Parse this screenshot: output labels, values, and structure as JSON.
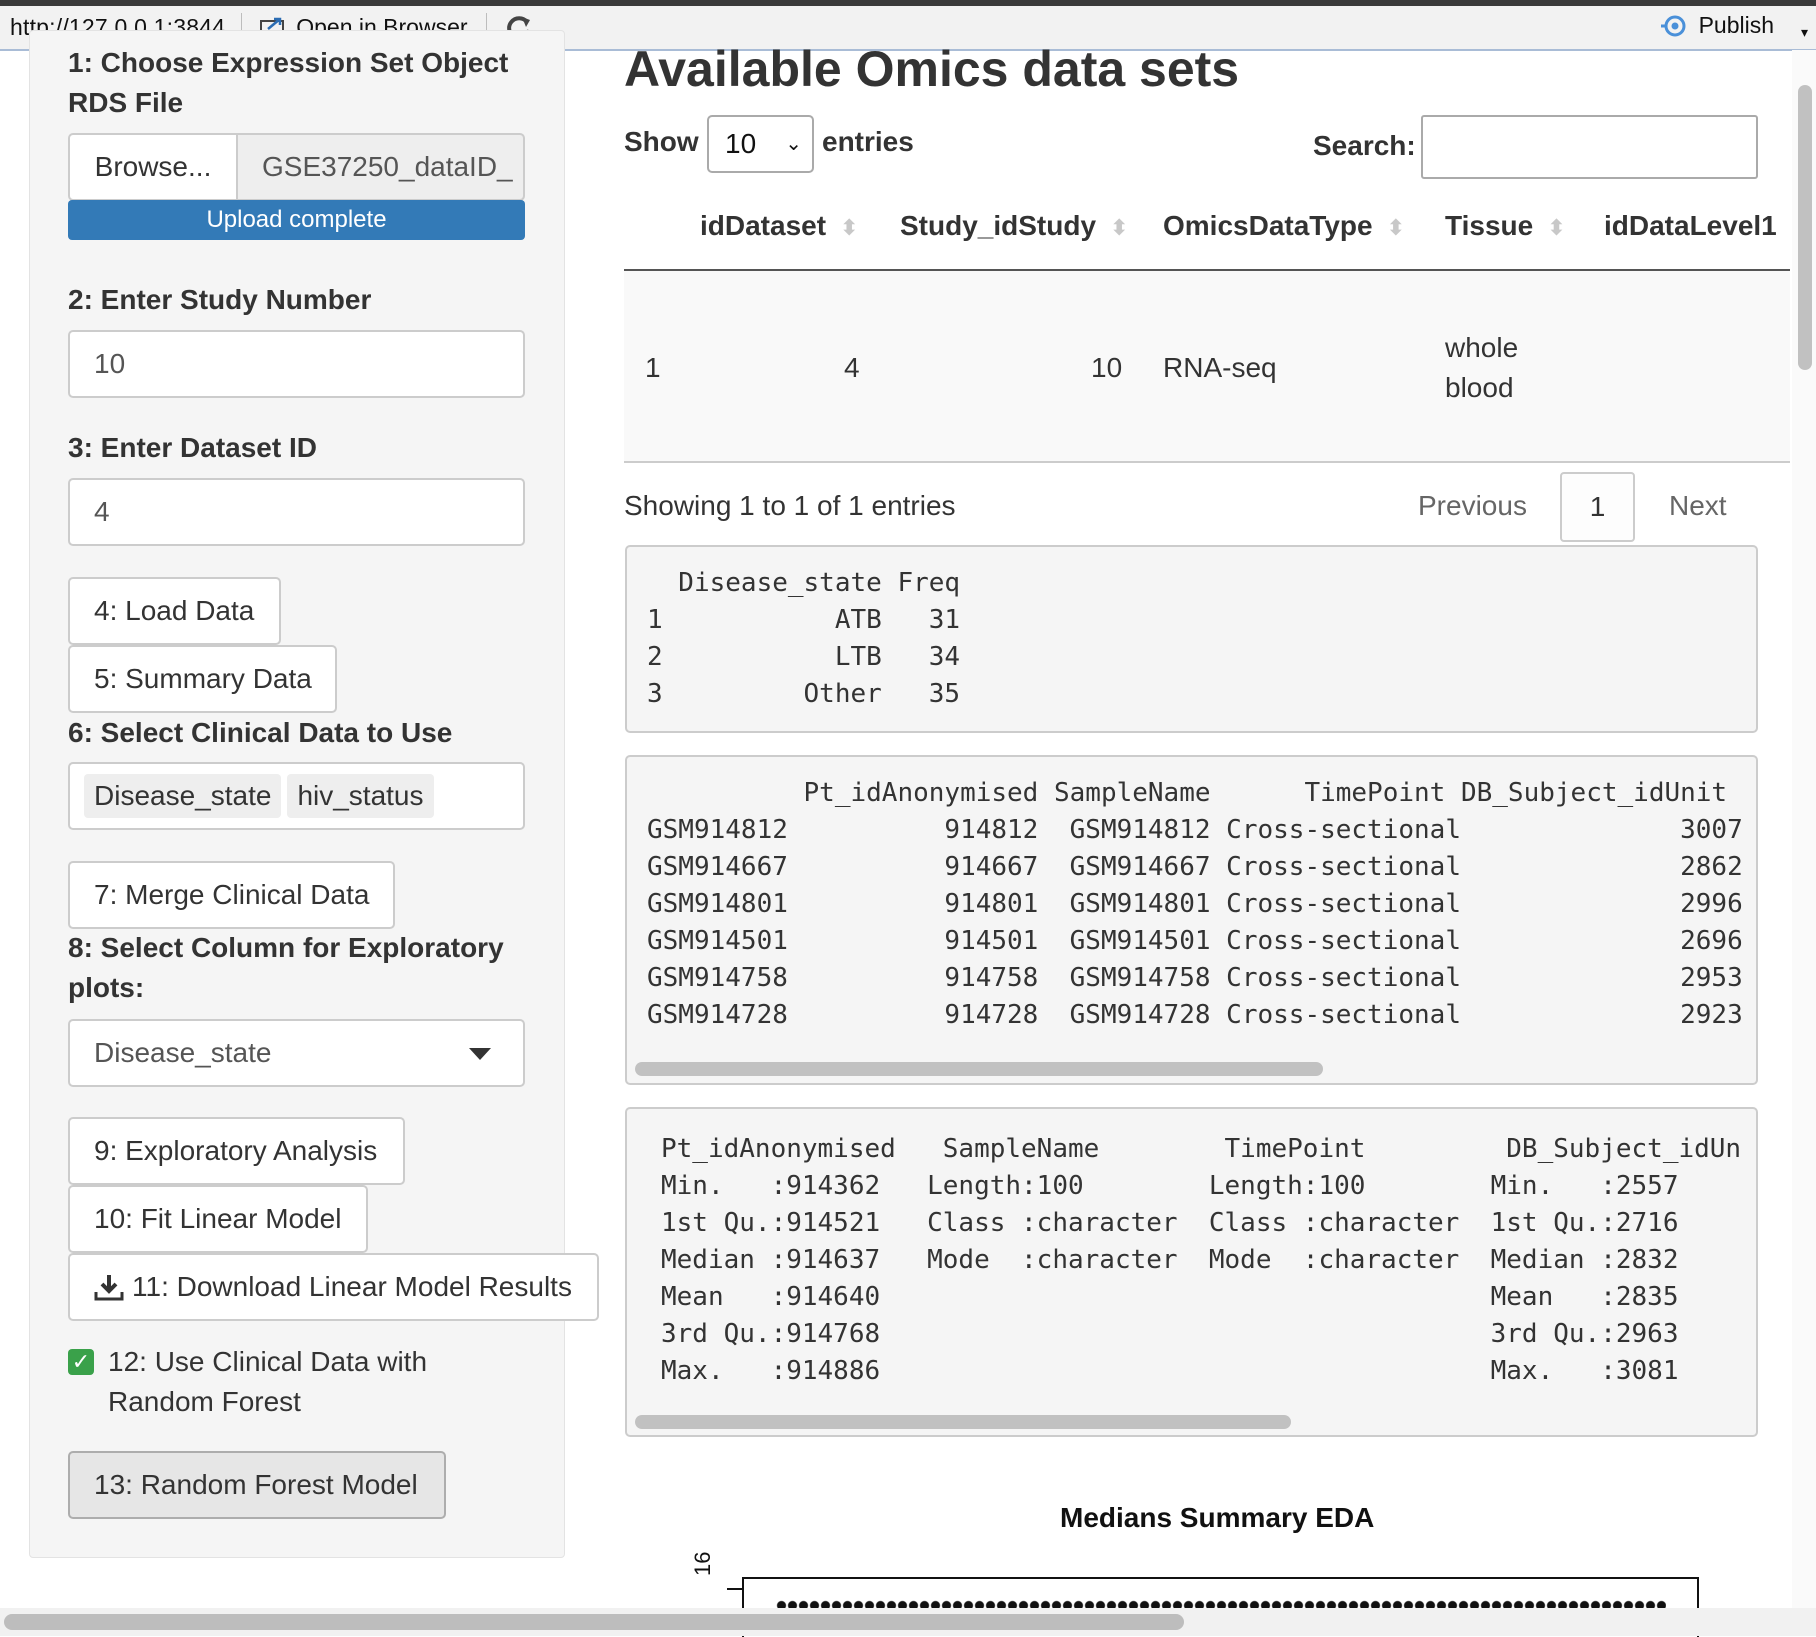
{
  "toolbar": {
    "url": "http://127.0.0.1:3844",
    "open_in_browser": "Open in Browser",
    "publish": "Publish"
  },
  "sidebar": {
    "step1_label": "1: Choose Expression Set Object RDS File",
    "browse_label": "Browse...",
    "file_name": "GSE37250_dataID_",
    "upload_status": "Upload complete",
    "step2_label": "2: Enter Study Number",
    "study_number": "10",
    "step3_label": "3: Enter Dataset ID",
    "dataset_id": "4",
    "load_data": "4: Load Data",
    "summary_data": "5: Summary Data",
    "step6_label": "6: Select Clinical Data to Use",
    "clinical_tags": [
      "Disease_state",
      "hiv_status"
    ],
    "merge_clinical": "7: Merge Clinical Data",
    "step8_label": "8: Select Column for Exploratory plots:",
    "exploratory_column": "Disease_state",
    "exploratory_analysis": "9: Exploratory Analysis",
    "fit_linear": "10: Fit Linear Model",
    "download_linear": "11: Download Linear Model Results",
    "use_clinical_rf": "12: Use Clinical Data with Random Forest",
    "random_forest": "13: Random Forest Model"
  },
  "main": {
    "title": "Available Omics data sets",
    "show_label": "Show",
    "entries_value": "10",
    "entries_label": "entries",
    "search_label": "Search:",
    "columns": [
      "idDataset",
      "Study_idStudy",
      "OmicsDataType",
      "Tissue",
      "idDataLevel1"
    ],
    "row": {
      "index": "1",
      "idDataset": "4",
      "Study_idStudy": "10",
      "OmicsDataType": "RNA-seq",
      "Tissue_line1": "whole",
      "Tissue_line2": "blood"
    },
    "info": "Showing 1 to 1 of 1 entries",
    "previous": "Previous",
    "current_page": "1",
    "next": "Next"
  },
  "freq_table": [
    "  Disease_state Freq",
    "1           ATB   31",
    "2           LTB   34",
    "3         Other   35"
  ],
  "sample_table": [
    "          Pt_idAnonymised SampleName      TimePoint DB_Subject_idUnit",
    "GSM914812          914812  GSM914812 Cross-sectional              3007",
    "GSM914667          914667  GSM914667 Cross-sectional              2862",
    "GSM914801          914801  GSM914801 Cross-sectional              2996",
    "GSM914501          914501  GSM914501 Cross-sectional              2696",
    "GSM914758          914758  GSM914758 Cross-sectional              2953",
    "GSM914728          914728  GSM914728 Cross-sectional              2923"
  ],
  "summary_table": [
    "Pt_idAnonymised   SampleName        TimePoint         DB_Subject_idUn",
    "Min.   :914362   Length:100        Length:100        Min.   :2557",
    "1st Qu.:914521   Class :character  Class :character  1st Qu.:2716",
    "Median :914637   Mode  :character  Mode  :character  Median :2832",
    "Mean   :914640                                       Mean   :2835",
    "3rd Qu.:914768                                       3rd Qu.:2963",
    "Max.   :914886                                       Max.   :3081"
  ],
  "plot": {
    "title": "Medians Summary EDA",
    "ytick": "16"
  }
}
